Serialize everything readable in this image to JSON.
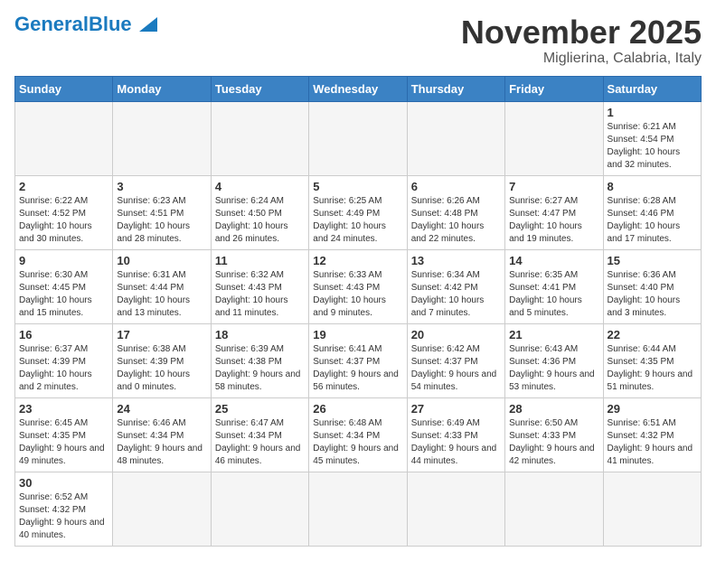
{
  "header": {
    "logo_general": "General",
    "logo_blue": "Blue",
    "title": "November 2025",
    "subtitle": "Miglierina, Calabria, Italy"
  },
  "days_of_week": [
    "Sunday",
    "Monday",
    "Tuesday",
    "Wednesday",
    "Thursday",
    "Friday",
    "Saturday"
  ],
  "weeks": [
    [
      {
        "day": "",
        "info": ""
      },
      {
        "day": "",
        "info": ""
      },
      {
        "day": "",
        "info": ""
      },
      {
        "day": "",
        "info": ""
      },
      {
        "day": "",
        "info": ""
      },
      {
        "day": "",
        "info": ""
      },
      {
        "day": "1",
        "info": "Sunrise: 6:21 AM\nSunset: 4:54 PM\nDaylight: 10 hours and 32 minutes."
      }
    ],
    [
      {
        "day": "2",
        "info": "Sunrise: 6:22 AM\nSunset: 4:52 PM\nDaylight: 10 hours and 30 minutes."
      },
      {
        "day": "3",
        "info": "Sunrise: 6:23 AM\nSunset: 4:51 PM\nDaylight: 10 hours and 28 minutes."
      },
      {
        "day": "4",
        "info": "Sunrise: 6:24 AM\nSunset: 4:50 PM\nDaylight: 10 hours and 26 minutes."
      },
      {
        "day": "5",
        "info": "Sunrise: 6:25 AM\nSunset: 4:49 PM\nDaylight: 10 hours and 24 minutes."
      },
      {
        "day": "6",
        "info": "Sunrise: 6:26 AM\nSunset: 4:48 PM\nDaylight: 10 hours and 22 minutes."
      },
      {
        "day": "7",
        "info": "Sunrise: 6:27 AM\nSunset: 4:47 PM\nDaylight: 10 hours and 19 minutes."
      },
      {
        "day": "8",
        "info": "Sunrise: 6:28 AM\nSunset: 4:46 PM\nDaylight: 10 hours and 17 minutes."
      }
    ],
    [
      {
        "day": "9",
        "info": "Sunrise: 6:30 AM\nSunset: 4:45 PM\nDaylight: 10 hours and 15 minutes."
      },
      {
        "day": "10",
        "info": "Sunrise: 6:31 AM\nSunset: 4:44 PM\nDaylight: 10 hours and 13 minutes."
      },
      {
        "day": "11",
        "info": "Sunrise: 6:32 AM\nSunset: 4:43 PM\nDaylight: 10 hours and 11 minutes."
      },
      {
        "day": "12",
        "info": "Sunrise: 6:33 AM\nSunset: 4:43 PM\nDaylight: 10 hours and 9 minutes."
      },
      {
        "day": "13",
        "info": "Sunrise: 6:34 AM\nSunset: 4:42 PM\nDaylight: 10 hours and 7 minutes."
      },
      {
        "day": "14",
        "info": "Sunrise: 6:35 AM\nSunset: 4:41 PM\nDaylight: 10 hours and 5 minutes."
      },
      {
        "day": "15",
        "info": "Sunrise: 6:36 AM\nSunset: 4:40 PM\nDaylight: 10 hours and 3 minutes."
      }
    ],
    [
      {
        "day": "16",
        "info": "Sunrise: 6:37 AM\nSunset: 4:39 PM\nDaylight: 10 hours and 2 minutes."
      },
      {
        "day": "17",
        "info": "Sunrise: 6:38 AM\nSunset: 4:39 PM\nDaylight: 10 hours and 0 minutes."
      },
      {
        "day": "18",
        "info": "Sunrise: 6:39 AM\nSunset: 4:38 PM\nDaylight: 9 hours and 58 minutes."
      },
      {
        "day": "19",
        "info": "Sunrise: 6:41 AM\nSunset: 4:37 PM\nDaylight: 9 hours and 56 minutes."
      },
      {
        "day": "20",
        "info": "Sunrise: 6:42 AM\nSunset: 4:37 PM\nDaylight: 9 hours and 54 minutes."
      },
      {
        "day": "21",
        "info": "Sunrise: 6:43 AM\nSunset: 4:36 PM\nDaylight: 9 hours and 53 minutes."
      },
      {
        "day": "22",
        "info": "Sunrise: 6:44 AM\nSunset: 4:35 PM\nDaylight: 9 hours and 51 minutes."
      }
    ],
    [
      {
        "day": "23",
        "info": "Sunrise: 6:45 AM\nSunset: 4:35 PM\nDaylight: 9 hours and 49 minutes."
      },
      {
        "day": "24",
        "info": "Sunrise: 6:46 AM\nSunset: 4:34 PM\nDaylight: 9 hours and 48 minutes."
      },
      {
        "day": "25",
        "info": "Sunrise: 6:47 AM\nSunset: 4:34 PM\nDaylight: 9 hours and 46 minutes."
      },
      {
        "day": "26",
        "info": "Sunrise: 6:48 AM\nSunset: 4:34 PM\nDaylight: 9 hours and 45 minutes."
      },
      {
        "day": "27",
        "info": "Sunrise: 6:49 AM\nSunset: 4:33 PM\nDaylight: 9 hours and 44 minutes."
      },
      {
        "day": "28",
        "info": "Sunrise: 6:50 AM\nSunset: 4:33 PM\nDaylight: 9 hours and 42 minutes."
      },
      {
        "day": "29",
        "info": "Sunrise: 6:51 AM\nSunset: 4:32 PM\nDaylight: 9 hours and 41 minutes."
      }
    ],
    [
      {
        "day": "30",
        "info": "Sunrise: 6:52 AM\nSunset: 4:32 PM\nDaylight: 9 hours and 40 minutes."
      },
      {
        "day": "",
        "info": ""
      },
      {
        "day": "",
        "info": ""
      },
      {
        "day": "",
        "info": ""
      },
      {
        "day": "",
        "info": ""
      },
      {
        "day": "",
        "info": ""
      },
      {
        "day": "",
        "info": ""
      }
    ]
  ]
}
